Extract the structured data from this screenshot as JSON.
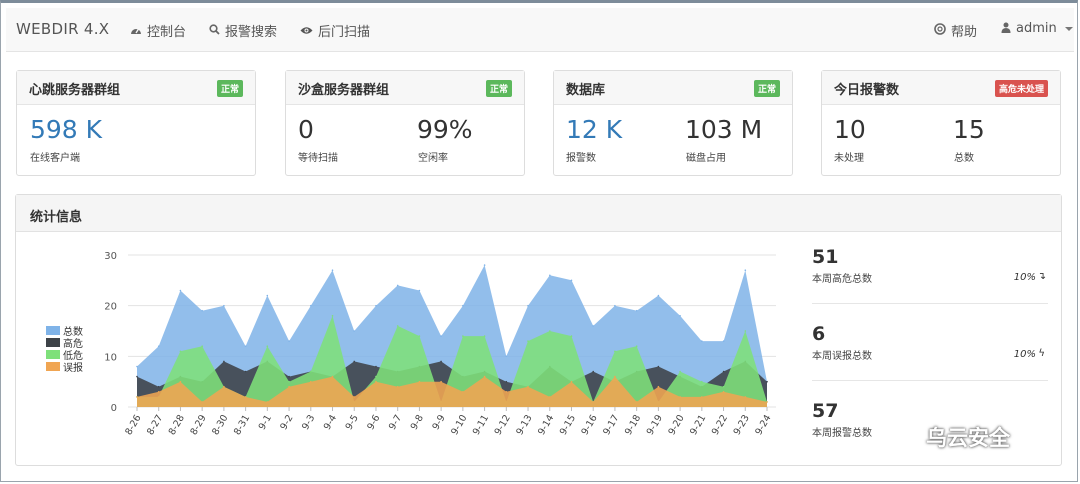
{
  "navbar": {
    "brand": "WEBDIR 4.X",
    "items": [
      {
        "label": "控制台",
        "icon": "dashboard-icon"
      },
      {
        "label": "报警搜索",
        "icon": "search-icon"
      },
      {
        "label": "后门扫描",
        "icon": "eye-icon"
      }
    ],
    "help_label": "帮助",
    "user_label": "admin"
  },
  "panels": [
    {
      "title": "心跳服务器群组",
      "badge": "正常",
      "badge_color": "#5cb85c",
      "stats": [
        {
          "value": "598 K",
          "label": "在线客户端",
          "color": "#337ab7"
        }
      ]
    },
    {
      "title": "沙盒服务器群组",
      "badge": "正常",
      "badge_color": "#5cb85c",
      "stats": [
        {
          "value": "0",
          "label": "等待扫描",
          "color": "#333333"
        },
        {
          "value": "99%",
          "label": "空闲率",
          "color": "#333333"
        }
      ]
    },
    {
      "title": "数据库",
      "badge": "正常",
      "badge_color": "#5cb85c",
      "stats": [
        {
          "value": "12 K",
          "label": "报警数",
          "color": "#337ab7"
        },
        {
          "value": "103 M",
          "label": "磁盘占用",
          "color": "#333333"
        }
      ]
    },
    {
      "title": "今日报警数",
      "badge": "高危未处理",
      "badge_color": "#d9534f",
      "stats": [
        {
          "value": "10",
          "label": "未处理",
          "color": "#333333"
        },
        {
          "value": "15",
          "label": "总数",
          "color": "#333333"
        }
      ]
    }
  ],
  "stats_panel": {
    "title": "统计信息"
  },
  "summary": [
    {
      "value": "51",
      "label": "本周高危总数",
      "change": "10%",
      "trend": "down"
    },
    {
      "value": "6",
      "label": "本周误报总数",
      "change": "10%",
      "trend": "up"
    },
    {
      "value": "57",
      "label": "本周报警总数",
      "change": "",
      "trend": "up"
    }
  ],
  "watermark": "乌云安全",
  "colors": {
    "total": "#7fb3e8",
    "high": "#3d4248",
    "low": "#7ee07a",
    "false": "#f0a552"
  },
  "chart_data": {
    "type": "area",
    "categories": [
      "8-26",
      "8-27",
      "8-28",
      "8-29",
      "8-30",
      "8-31",
      "9-1",
      "9-2",
      "9-3",
      "9-4",
      "9-5",
      "9-6",
      "9-7",
      "9-8",
      "9-9",
      "9-10",
      "9-11",
      "9-12",
      "9-13",
      "9-14",
      "9-15",
      "9-16",
      "9-17",
      "9-18",
      "9-19",
      "9-20",
      "9-21",
      "9-22",
      "9-23",
      "9-24"
    ],
    "ylim": [
      0,
      30
    ],
    "yticks": [
      0,
      10,
      20,
      30
    ],
    "series": [
      {
        "name": "总数",
        "values": [
          8,
          12,
          23,
          19,
          20,
          12,
          22,
          13,
          20,
          27,
          15,
          20,
          24,
          23,
          14,
          20,
          28,
          10,
          20,
          26,
          25,
          16,
          20,
          19,
          22,
          18,
          13,
          13,
          27,
          5
        ]
      },
      {
        "name": "高危",
        "values": [
          6,
          4,
          6,
          5,
          9,
          7,
          9,
          6,
          7,
          6,
          9,
          8,
          7,
          8,
          9,
          6,
          7,
          5,
          4,
          8,
          5,
          7,
          5,
          7,
          8,
          6,
          4,
          7,
          9,
          5
        ]
      },
      {
        "name": "低危",
        "values": [
          2,
          2,
          11,
          12,
          4,
          2,
          12,
          5,
          7,
          18,
          1,
          6,
          16,
          14,
          1,
          14,
          14,
          1,
          13,
          15,
          14,
          1,
          11,
          12,
          1,
          7,
          5,
          4,
          15,
          1
        ]
      },
      {
        "name": "误报",
        "values": [
          2,
          3,
          5,
          1,
          4,
          2,
          1,
          4,
          5,
          6,
          2,
          5,
          4,
          5,
          5,
          3,
          6,
          3,
          4,
          2,
          5,
          1,
          6,
          1,
          4,
          2,
          2,
          3,
          2,
          1
        ]
      }
    ]
  }
}
